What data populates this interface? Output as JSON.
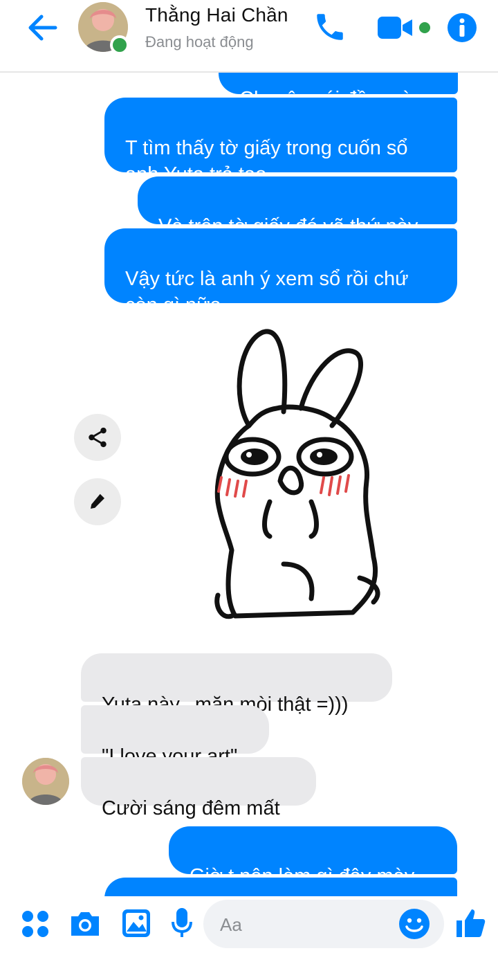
{
  "header": {
    "contact_name": "Thằng Hai Chần",
    "status": "Đang hoạt động",
    "accent_color": "#0084ff",
    "online_color": "#31a24c"
  },
  "messages": [
    {
      "direction": "out",
      "text": "Chuyện cái đầu mày"
    },
    {
      "direction": "out",
      "text": "T tìm thấy tờ giấy trong cuốn sổ\nanh Yuta trả tao"
    },
    {
      "direction": "out",
      "text": "Và trên tờ giấy đó vẽ thứ này"
    },
    {
      "direction": "out",
      "text": "Vậy tức là anh ý xem sổ rồi chứ\ncòn gì nữa"
    },
    {
      "direction": "out",
      "type": "sticker",
      "sticker": "crying-bunny"
    },
    {
      "direction": "in",
      "text": "Yuta này...mặn mòi thật =)))"
    },
    {
      "direction": "in",
      "text": "\"I love your art\""
    },
    {
      "direction": "in",
      "text": "Cười sáng đêm mất"
    },
    {
      "direction": "out",
      "text": "Giờ t nên làm gì đây mày"
    },
    {
      "direction": "out",
      "text": ""
    }
  ],
  "sticker_actions": {
    "share_icon": "share-icon",
    "edit_icon": "pencil-icon"
  },
  "composer": {
    "placeholder": "Aa",
    "icons": [
      "apps-icon",
      "camera-icon",
      "gallery-icon",
      "microphone-icon",
      "emoji-icon",
      "thumbs-up-icon"
    ]
  }
}
